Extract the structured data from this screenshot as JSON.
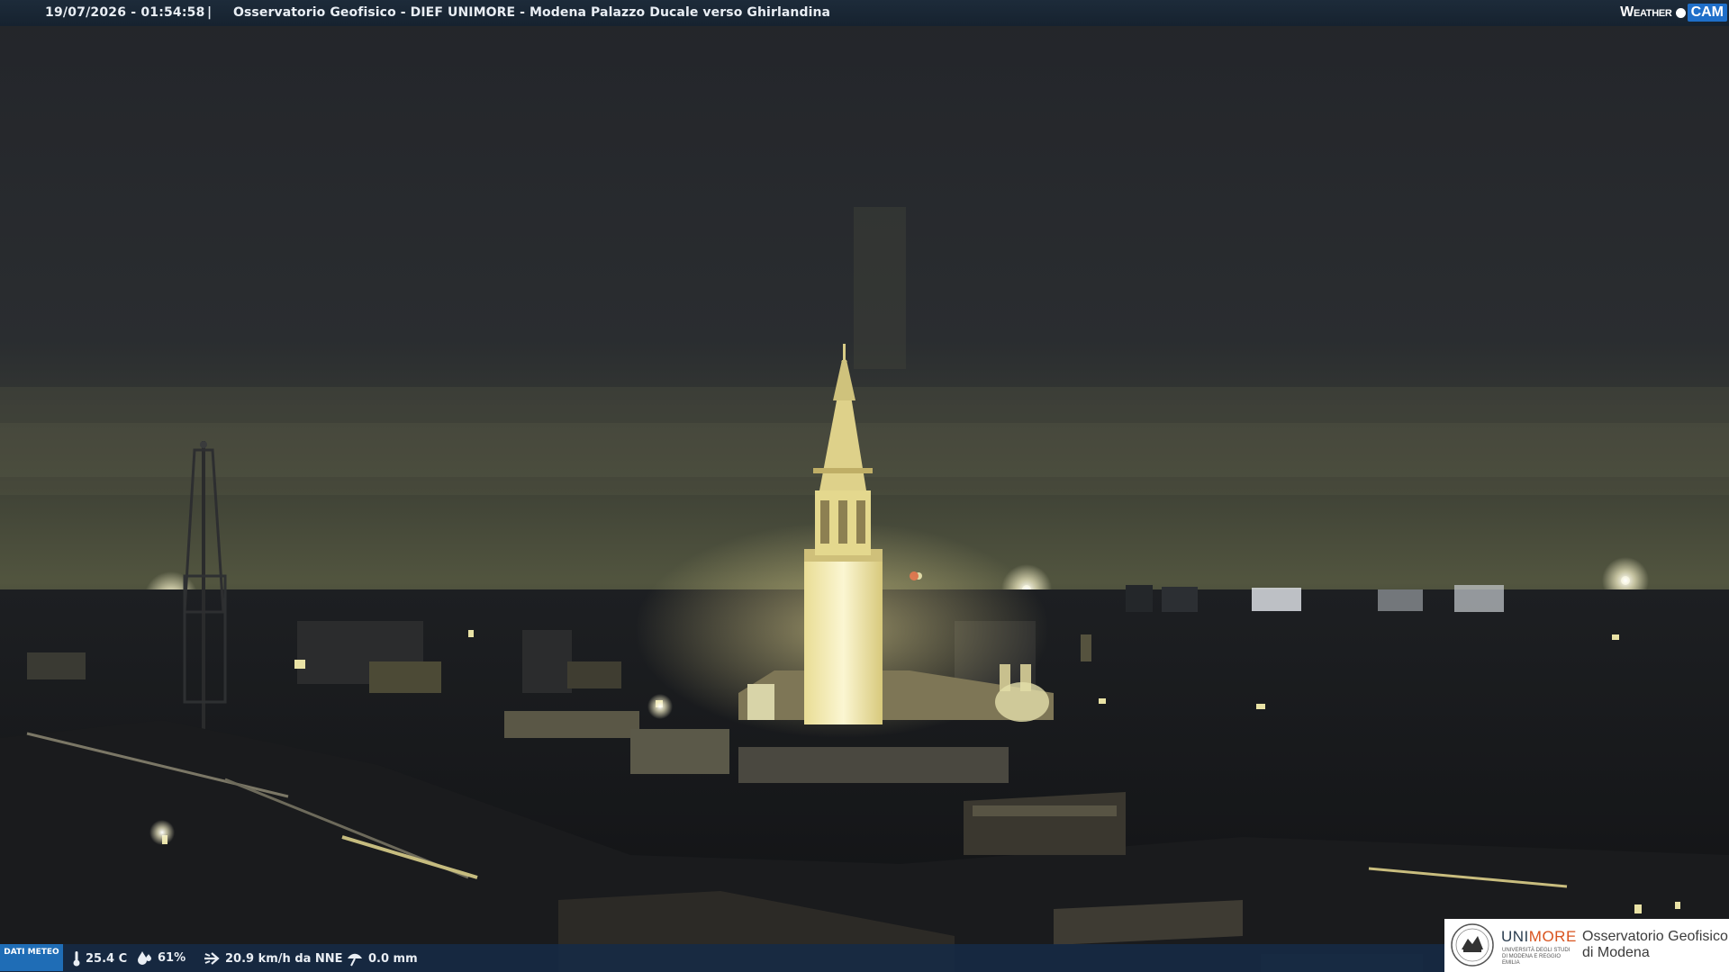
{
  "topbar": {
    "timestamp": "19/07/2026 - 01:54:58",
    "separator": "|",
    "camera_title": "Osservatorio Geofisico - DIEF UNIMORE - Modena Palazzo Ducale verso Ghirlandina",
    "brand_weather": "Weather",
    "brand_cam": "CAM"
  },
  "meteo": {
    "label": "DATI METEO",
    "temperature": "25.4 C",
    "humidity": "61%",
    "wind": "20.9 km/h da NNE",
    "rain": "0.0 mm",
    "icons": [
      "thermometer-icon",
      "humidity-drop-icon",
      "wind-icon",
      "rain-gauge-icon"
    ]
  },
  "logo": {
    "university_part1": "UNI",
    "university_part2": "MORE",
    "university_sub": "UNIVERSITÀ DEGLI STUDI DI MODENA E REGGIO EMILIA",
    "observatory_line1": "Osservatorio Geofisico",
    "observatory_line2": "di Modena"
  },
  "colors": {
    "bar": "#1a2634",
    "brand_blue": "#1f6fc9",
    "unimore_orange": "#d9531e",
    "tower_light": "#f3ecb0"
  }
}
